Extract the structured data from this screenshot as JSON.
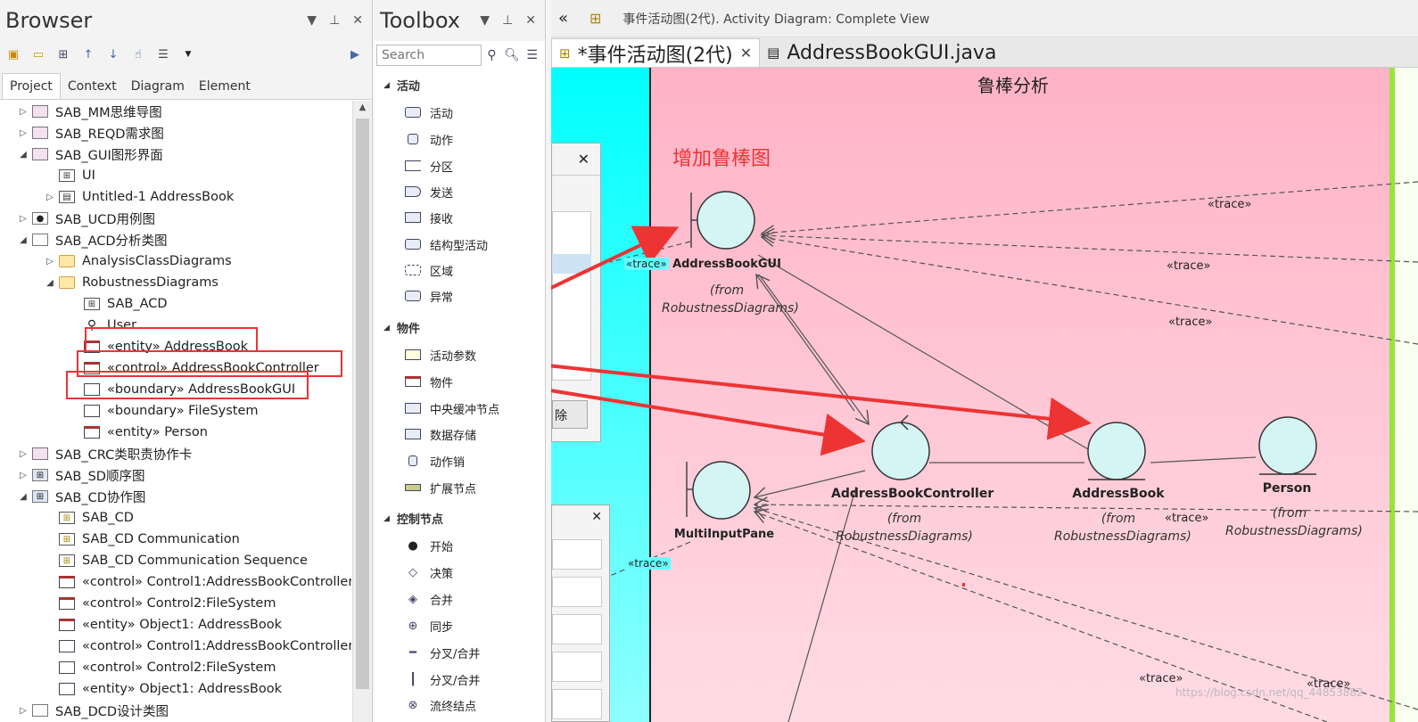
{
  "browser": {
    "title": "Browser",
    "tabs": [
      "Project",
      "Context",
      "Diagram",
      "Element"
    ],
    "tree": [
      {
        "label": "SAB_MM思维导图"
      },
      {
        "label": "SAB_REQD需求图"
      },
      {
        "label": "SAB_GUI图形界面"
      },
      {
        "label": "UI"
      },
      {
        "label": "Untitled-1 AddressBook"
      },
      {
        "label": "SAB_UCD用例图"
      },
      {
        "label": "SAB_ACD分析类图"
      },
      {
        "label": "AnalysisClassDiagrams"
      },
      {
        "label": "RobustnessDiagrams"
      },
      {
        "label": "SAB_ACD"
      },
      {
        "label": "User"
      },
      {
        "label": "«entity» AddressBook"
      },
      {
        "label": "«control» AddressBookController"
      },
      {
        "label": "«boundary» AddressBookGUI"
      },
      {
        "label": "«boundary» FileSystem"
      },
      {
        "label": "«entity» Person"
      },
      {
        "label": "SAB_CRC类职责协作卡"
      },
      {
        "label": "SAB_SD顺序图"
      },
      {
        "label": "SAB_CD协作图"
      },
      {
        "label": "SAB_CD"
      },
      {
        "label": "SAB_CD Communication"
      },
      {
        "label": "SAB_CD Communication Sequence"
      },
      {
        "label": "«control» Control1:AddressBookController"
      },
      {
        "label": "«control» Control2:FileSystem"
      },
      {
        "label": "«entity» Object1: AddressBook"
      },
      {
        "label": "«control» Control1:AddressBookController"
      },
      {
        "label": "«control» Control2:FileSystem"
      },
      {
        "label": "«entity» Object1: AddressBook"
      },
      {
        "label": "SAB_DCD设计类图"
      }
    ]
  },
  "toolbox": {
    "title": "Toolbox",
    "search_placeholder": "Search",
    "sections": [
      {
        "title": "活动",
        "items": [
          "活动",
          "动作",
          "分区",
          "发送",
          "接收",
          "结构型活动",
          "区域",
          "异常"
        ]
      },
      {
        "title": "物件",
        "items": [
          "活动参数",
          "物件",
          "中央缓冲节点",
          "数据存储",
          "动作销",
          "扩展节点"
        ]
      },
      {
        "title": "控制节点",
        "items": [
          "开始",
          "决策",
          "合并",
          "同步",
          "分叉/合并",
          "分叉/合并",
          "流终结点"
        ]
      }
    ]
  },
  "diagram": {
    "titlebar": "事件活动图(2代).  Activity Diagram: Complete View",
    "tabs": [
      {
        "label": "*事件活动图(2代)",
        "active": true
      },
      {
        "label": "AddressBookGUI.java",
        "active": false
      }
    ],
    "partition_title": "鲁棒分析",
    "annotation": "增加鲁棒图",
    "trace_label": "«trace»",
    "from_label": "(from",
    "from_package": "RobustnessDiagrams)",
    "dialog_button": "除",
    "elements": {
      "gui": "AddressBookGUI",
      "controller": "AddressBookController",
      "addressbook": "AddressBook",
      "person": "Person",
      "multiinput": "MultiInputPane"
    },
    "watermark": "https://blog.csdn.net/qq_44853882"
  },
  "colors": {
    "cyan": "#00ffff",
    "pink": "#ffb3c6",
    "red": "#ee3333",
    "green": "#9be33b"
  }
}
